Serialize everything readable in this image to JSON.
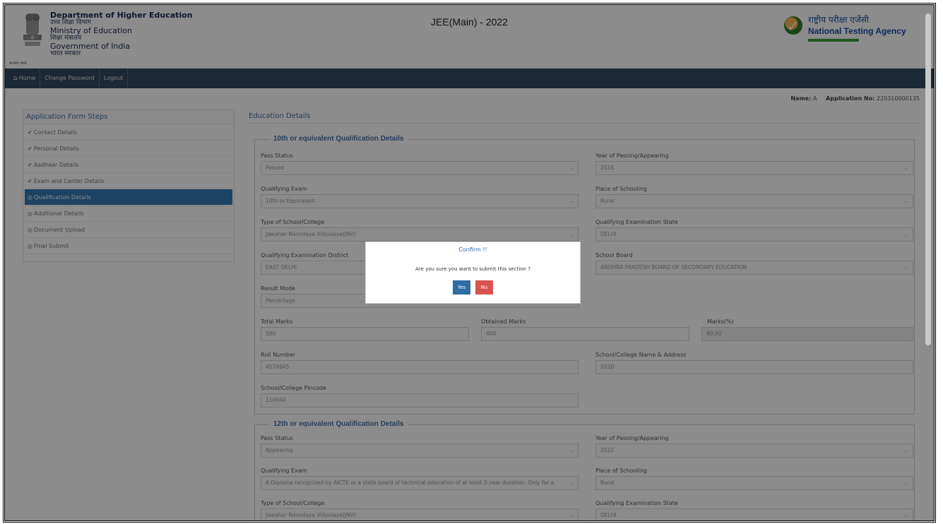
{
  "header": {
    "dept_en": "Department of Higher Education",
    "dept_hi": "उच्च शिक्षा विभाग",
    "ministry_en": "Ministry of Education",
    "ministry_hi": "शिक्षा मंत्रालय",
    "govt_en": "Government of India",
    "govt_hi": "भारत सरकार",
    "motto": "सत्यमेव जयते",
    "exam_title": "JEE(Main) - 2022",
    "nta_hi": "राष्ट्रीय परीक्षा एजेंसी",
    "nta_en": "National Testing Agency"
  },
  "nav": {
    "home": "Home",
    "change_password": "Change Password",
    "logout": "Logout"
  },
  "user": {
    "name_label": "Name:",
    "name_value": "A",
    "app_label": "Application No:",
    "app_value": "220310000135"
  },
  "sidebar": {
    "title": "Application Form Steps",
    "items": [
      {
        "label": "Contact Details",
        "icon": "check-circle-icon"
      },
      {
        "label": "Personal Details",
        "icon": "check-circle-icon"
      },
      {
        "label": "Aadhaar Details",
        "icon": "check-circle-icon"
      },
      {
        "label": "Exam and Center Details",
        "icon": "check-circle-icon"
      },
      {
        "label": "Qualification Details",
        "icon": "radio-circle-icon"
      },
      {
        "label": "Additional Details",
        "icon": "radio-circle-icon"
      },
      {
        "label": "Document Upload",
        "icon": "radio-circle-icon"
      },
      {
        "label": "Final Submit",
        "icon": "radio-circle-icon"
      }
    ]
  },
  "main": {
    "title": "Education Details",
    "sec10": {
      "legend": "10th or equivalent Qualification Details",
      "pass_status": {
        "label": "Pass Status",
        "value": "Passed"
      },
      "year": {
        "label": "Year of Passing/Appearing",
        "value": "2016"
      },
      "qual_exam": {
        "label": "Qualifying Exam",
        "value": "10th or Equivalent"
      },
      "place": {
        "label": "Place of Schooling",
        "value": "Rural"
      },
      "school_type": {
        "label": "Type of School/College",
        "value": "Jawahar Navodaya Vidyalaya(JNV)"
      },
      "qual_state": {
        "label": "Qualifying Examination State",
        "value": "DELHI"
      },
      "qual_district": {
        "label": "Qualifying Examination District",
        "value": "EAST DELHI"
      },
      "board": {
        "label": "School Board",
        "value": "ANDHRA PRADESH BOARD OF SECONDARY EDUCATION"
      },
      "result_mode": {
        "label": "Result Mode",
        "value": "Percentage"
      },
      "total": {
        "label": "Total Marks",
        "value": "500"
      },
      "obtained": {
        "label": "Obtained Marks",
        "value": "400"
      },
      "percent": {
        "label": "Marks(%)",
        "value": "80.00"
      },
      "roll": {
        "label": "Roll Number",
        "value": "4578945"
      },
      "school_name": {
        "label": "School/College Name & Address",
        "value": "SSSD"
      },
      "pincode": {
        "label": "School/College Pincode",
        "value": "110044"
      }
    },
    "sec12": {
      "legend": "12th or equivalent Qualification Details",
      "pass_status": {
        "label": "Pass Status",
        "value": "Appearing"
      },
      "year": {
        "label": "Year of Passing/Appearing",
        "value": "2022"
      },
      "qual_exam": {
        "label": "Qualifying Exam",
        "value": "A Diploma recognized by AICTE or a state board of technical education of at least 3 year duration. Only for a"
      },
      "place": {
        "label": "Place of Schooling",
        "value": "Rural"
      },
      "school_type": {
        "label": "Type of School/College",
        "value": "Jawahar Navodaya Vidyalaya(JNV)"
      },
      "qual_state": {
        "label": "Qualifying Examination State",
        "value": "DELHI"
      }
    }
  },
  "modal": {
    "title": "Confirm !!",
    "message": "Are you sure you want to submit this section ?",
    "yes": "Yes",
    "no": "No"
  }
}
